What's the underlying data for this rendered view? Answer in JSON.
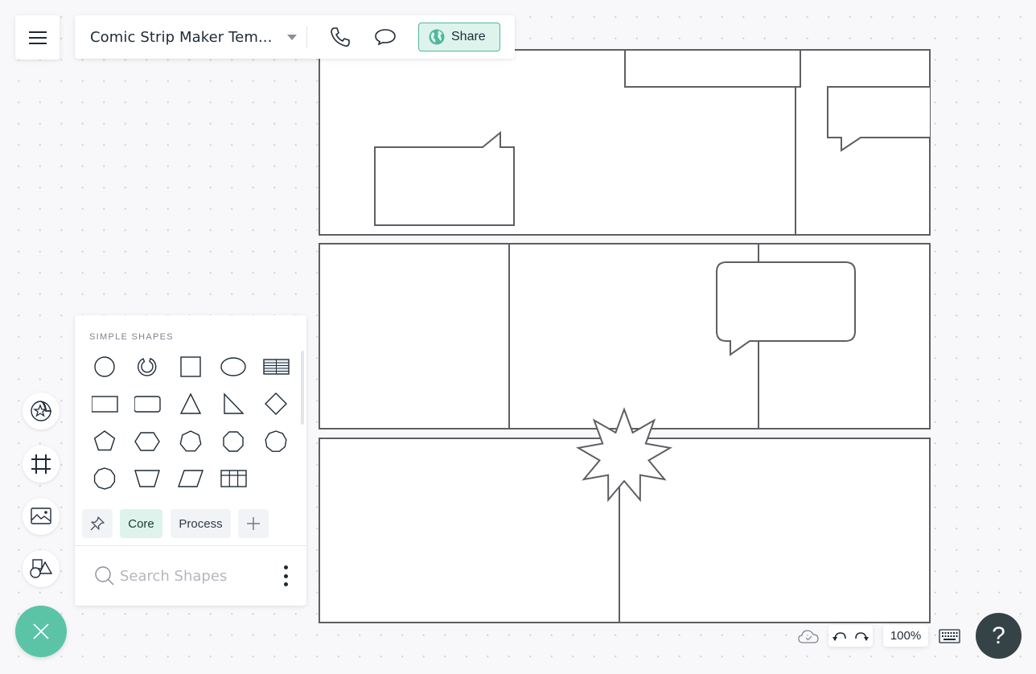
{
  "header": {
    "menu_icon": "hamburger-menu-icon",
    "document_title": "Comic Strip Maker Tem...",
    "title_dropdown_icon": "caret-down-icon",
    "call_icon": "phone-icon",
    "comment_icon": "speech-bubble-icon",
    "share_label": "Share",
    "share_icon": "globe-icon"
  },
  "colors": {
    "accent": "#5bc4a6",
    "share_bg": "#def3ec",
    "share_border": "#4fb89c",
    "help_bg": "#354347",
    "canvas_stroke": "#5f5f63"
  },
  "left_rail": {
    "items": [
      {
        "name": "sticker-star-icon"
      },
      {
        "name": "frame-grid-icon"
      },
      {
        "name": "image-icon"
      },
      {
        "name": "shapes-icon"
      }
    ],
    "close_icon": "close-x-icon"
  },
  "shapes_panel": {
    "heading": "SIMPLE SHAPES",
    "shapes": [
      "circle",
      "ring",
      "square",
      "ellipse",
      "table-lines",
      "rectangle",
      "rounded-rectangle",
      "triangle",
      "right-triangle",
      "diamond",
      "pentagon",
      "hexagon",
      "heptagon",
      "octagon",
      "nonagon",
      "decagon",
      "trapezoid",
      "parallelogram",
      "grid-table"
    ],
    "tabs": [
      {
        "id": "pin",
        "icon": "pin-icon",
        "label": ""
      },
      {
        "id": "core",
        "label": "Core",
        "active": true
      },
      {
        "id": "process",
        "label": "Process",
        "active": false
      },
      {
        "id": "add",
        "icon": "plus-icon",
        "label": ""
      }
    ],
    "search": {
      "placeholder": "Search Shapes",
      "value": "",
      "icon": "search-icon",
      "more_icon": "more-vertical-icon"
    }
  },
  "canvas": {
    "template": "Comic Strip",
    "panels": [
      {
        "row": 1,
        "cells": 2,
        "elements": [
          "caption-box",
          "speech-bubble-square",
          "speech-bubble-square"
        ]
      },
      {
        "row": 2,
        "cells": 3,
        "elements": [
          "speech-bubble-rounded"
        ]
      },
      {
        "row": 3,
        "cells": 2,
        "elements": [
          "starburst"
        ]
      }
    ]
  },
  "footer": {
    "save_status_icon": "cloud-check-icon",
    "undo_icon": "undo-icon",
    "redo_icon": "redo-icon",
    "zoom_level": "100%",
    "keyboard_icon": "keyboard-icon",
    "help_label": "?"
  }
}
